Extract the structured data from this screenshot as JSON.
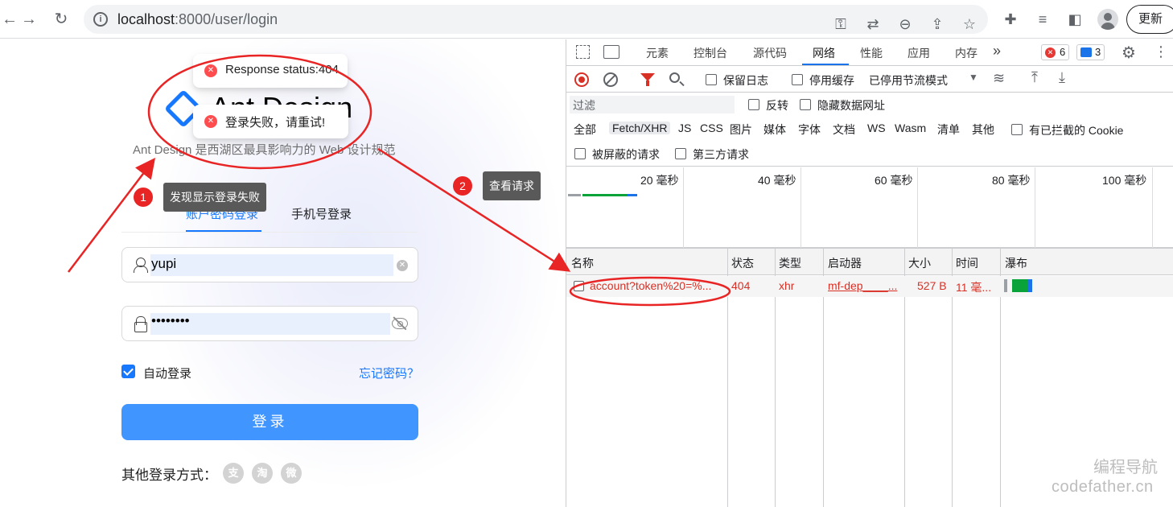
{
  "browser": {
    "url_host": "localhost",
    "url_path": ":8000/user/login",
    "update_label": "更新",
    "icons": [
      "back-icon",
      "forward-icon",
      "reload-icon",
      "info-icon",
      "key-icon",
      "translate-icon",
      "zoom-icon",
      "share-icon",
      "star-icon",
      "extensions-icon",
      "reading-list-icon",
      "side-panel-icon",
      "profile-icon"
    ]
  },
  "login": {
    "logo_title": "Ant Design",
    "subtitle": "Ant Design 是西湖区最具影响力的 Web 设计规范",
    "tabs": [
      {
        "label": "账户密码登录",
        "active": true
      },
      {
        "label": "手机号登录",
        "active": false
      }
    ],
    "username": "yupi",
    "password_mask": "••••••••",
    "auto_login_label": "自动登录",
    "auto_login_checked": true,
    "forgot_label": "忘记密码？",
    "submit_label": "登录",
    "other_label": "其他登录方式：",
    "social": [
      {
        "name": "alipay-icon",
        "glyph": "支"
      },
      {
        "name": "taobao-icon",
        "glyph": "淘"
      },
      {
        "name": "weibo-icon",
        "glyph": "微"
      }
    ],
    "brand_color": "#1677ff"
  },
  "toasts": [
    {
      "message": "Response status:404"
    },
    {
      "message": "登录失败，请重试!"
    }
  ],
  "annotations": {
    "step1": {
      "number": "1",
      "text": "发现显示登录失败"
    },
    "step2": {
      "number": "2",
      "text": "查看请求"
    },
    "annotation_color": "#e82424"
  },
  "devtools": {
    "tabs": [
      "元素",
      "控制台",
      "源代码",
      "网络",
      "性能",
      "应用",
      "内存"
    ],
    "active_tab": "网络",
    "more": "»",
    "errors_count": "6",
    "messages_count": "3",
    "preserve_log": "保留日志",
    "disable_cache": "停用缓存",
    "throttle": "已停用节流模式",
    "filter_placeholder": "过滤",
    "invert": "反转",
    "hide_data_urls": "隐藏数据网址",
    "types": [
      "全部",
      "Fetch/XHR",
      "JS",
      "CSS",
      "图片",
      "媒体",
      "字体",
      "文档",
      "WS",
      "Wasm",
      "清单",
      "其他"
    ],
    "active_type": "Fetch/XHR",
    "blocked_cookies": "有已拦截的 Cookie",
    "blocked_requests": "被屏蔽的请求",
    "third_party": "第三方请求",
    "timeline_labels": [
      "20 毫秒",
      "40 毫秒",
      "60 毫秒",
      "80 毫秒",
      "100 毫秒"
    ],
    "columns": [
      "名称",
      "状态",
      "类型",
      "启动器",
      "大小",
      "时间",
      "瀑布"
    ],
    "requests": [
      {
        "name": "account?token%20=%...",
        "status": "404",
        "type": "xhr",
        "initiator": "mf-dep____...",
        "size": "527 B",
        "time": "11 毫..."
      }
    ],
    "error_color": "#d93025"
  },
  "watermark": {
    "line1": "编程导航",
    "line2": "codefather.cn"
  }
}
